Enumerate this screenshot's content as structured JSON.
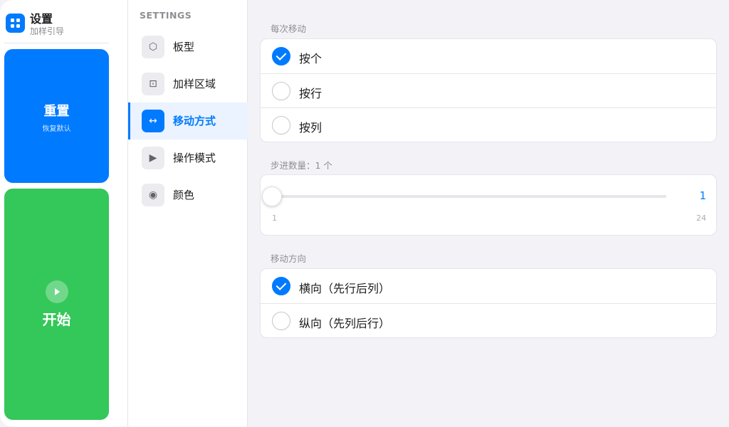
{
  "app": {
    "title": "设置",
    "subtitle": "加样引导"
  },
  "actions": {
    "reset_title": "重置",
    "reset_subtitle": "恢复默认",
    "start_title": "开始"
  },
  "nav": {
    "heading": "SETTINGS",
    "items": [
      {
        "label": "板型",
        "icon": "hexagon-icon",
        "glyph": "⬡",
        "active": false
      },
      {
        "label": "加样区域",
        "icon": "dotted-square-icon",
        "glyph": "⊡",
        "active": false
      },
      {
        "label": "移动方式",
        "icon": "horizontal-arrows-icon",
        "glyph": "↔",
        "active": true
      },
      {
        "label": "操作模式",
        "icon": "play-icon",
        "glyph": "▶",
        "active": false
      },
      {
        "label": "颜色",
        "icon": "color-dot-icon",
        "glyph": "◉",
        "active": false
      }
    ]
  },
  "move_step": {
    "label": "每次移动",
    "options": [
      {
        "label": "按个",
        "checked": true
      },
      {
        "label": "按行",
        "checked": false
      },
      {
        "label": "按列",
        "checked": false
      }
    ]
  },
  "step_count": {
    "label": "步进数量：1 个",
    "value": "1",
    "min": "1",
    "max": "24"
  },
  "direction": {
    "label": "移动方向",
    "options": [
      {
        "label": "横向（先行后列）",
        "checked": true
      },
      {
        "label": "纵向（先列后行）",
        "checked": false
      }
    ]
  },
  "colors": {
    "accent": "#007aff",
    "start_green": "#34c759",
    "background": "#f2f2f7"
  }
}
